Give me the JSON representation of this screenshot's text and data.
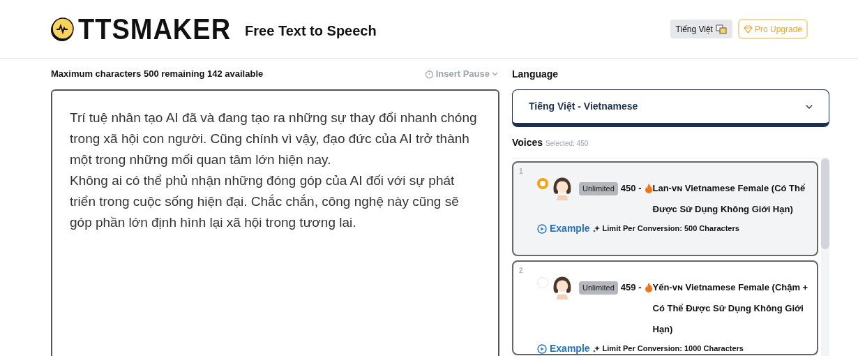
{
  "header": {
    "logo_text": "TTSMAKER",
    "tagline": "Free Text to Speech",
    "language_button": "Tiếng Việt",
    "upgrade_button": "Pro Upgrade"
  },
  "editor": {
    "char_info": "Maximum characters 500 remaining 142 available",
    "insert_pause": "Insert Pause",
    "text": "Trí tuệ nhân tạo AI đã và đang tạo ra những sự thay đổi nhanh chóng trong xã hội con người. Cũng chính vì vậy, đạo đức của AI trở thành một trong những mối quan tâm lớn hiện nay.\nKhông ai có thể phủ nhận những đóng góp của AI đối với sự phát triển trong cuộc sống hiện đại. Chắc chắn, công nghệ này cũng sẽ góp phần lớn định hình lại xã hội trong tương lai."
  },
  "language": {
    "label": "Language",
    "value": "Tiếng Việt - Vietnamese"
  },
  "voices": {
    "label": "Voices",
    "selected_info": "Selected: 450",
    "items": [
      {
        "index": "1",
        "selected": true,
        "badge": "Unlimited",
        "id_prefix": "450 -",
        "name": "Lan-ᴠɴ Vietnamese Female (Có Thể Được Sử Dụng Không Giới Hạn)",
        "example": "Example",
        "limit": "Limit Per Conversion: 500 Characters"
      },
      {
        "index": "2",
        "selected": false,
        "badge": "Unlimited",
        "id_prefix": "459 -",
        "name": "Yến-ᴠɴ Vietnamese Female (Chậm + Có Thể Được Sử Dụng Không Giới Hạn)",
        "example": "Example",
        "limit": "Limit Per Conversion: 1000 Characters"
      }
    ]
  }
}
